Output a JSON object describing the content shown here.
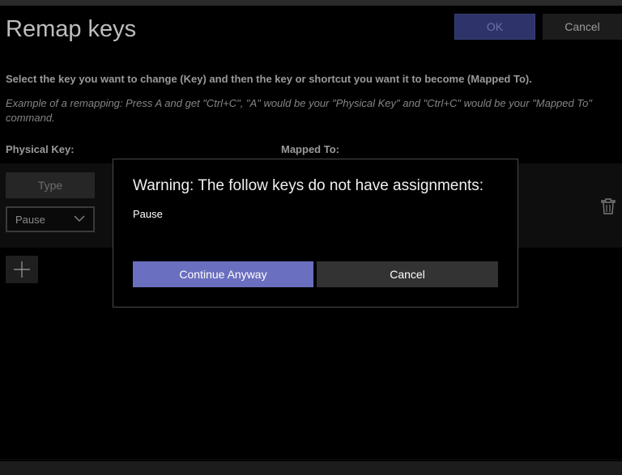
{
  "window": {
    "title": "Remap keys"
  },
  "toolbar": {
    "ok_label": "OK",
    "cancel_label": "Cancel"
  },
  "instructions": {
    "main": "Select the key you want to change (Key) and then the key or shortcut you want it to become (Mapped To).",
    "example": "Example of a remapping: Press A and get \"Ctrl+C\", \"A\" would be your \"Physical Key\" and \"Ctrl+C\" would be your \"Mapped To\" command."
  },
  "columns": {
    "physical_key": "Physical Key:",
    "mapped_to": "Mapped To:"
  },
  "row": {
    "type_button_label": "Type",
    "selected_key": "Pause",
    "delete_icon": "trash-icon"
  },
  "add_button": {
    "icon": "plus-icon"
  },
  "dialog": {
    "title": "Warning: The follow keys do not have assignments:",
    "keys": [
      "Pause"
    ],
    "continue_label": "Continue Anyway",
    "cancel_label": "Cancel"
  },
  "colors": {
    "background": "#000000",
    "accent": "#6b6fc0",
    "ok_disabled_bg": "#2e3469",
    "dialog_border": "#4a4a4a"
  }
}
